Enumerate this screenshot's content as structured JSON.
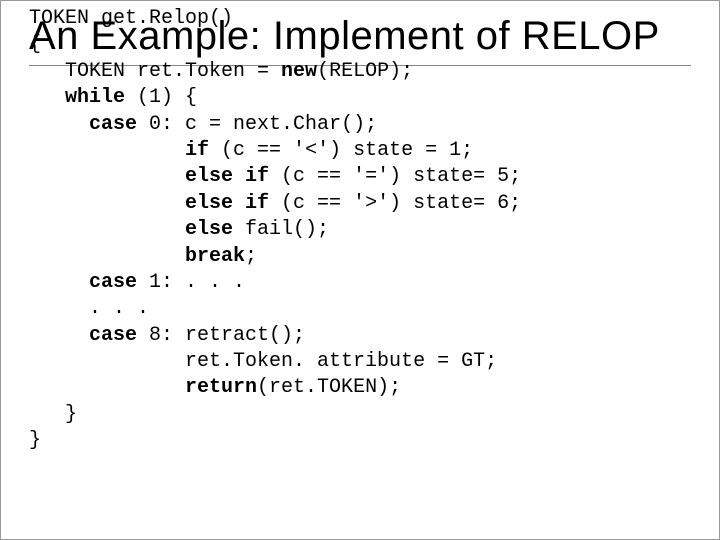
{
  "title": "An Example: Implement of RELOP",
  "code": {
    "l01a": "TOKEN get.Relop()",
    "l02a": "{",
    "l03a": "   TOKEN ret.Token = ",
    "l03b": "new",
    "l03c": "(RELOP);",
    "l04a": "   ",
    "l04b": "while",
    "l04c": " (1) {",
    "l05a": "     ",
    "l05b": "case",
    "l05c": " 0: c = next.Char();",
    "l06a": "             ",
    "l06b": "if",
    "l06c": " (c == '<') state = 1;",
    "l07a": "             ",
    "l07b": "else if",
    "l07c": " (c == '=') state= 5;",
    "l08a": "             ",
    "l08b": "else if",
    "l08c": " (c == '>') state= 6;",
    "l09a": "             ",
    "l09b": "else",
    "l09c": " fail();",
    "l10a": "             ",
    "l10b": "break",
    "l10c": ";",
    "l11a": "     ",
    "l11b": "case",
    "l11c": " 1: . . .",
    "l12a": "     . . .",
    "l13a": "     ",
    "l13b": "case",
    "l13c": " 8: retract();",
    "l14a": "             ret.Token. attribute = GT;",
    "l15a": "             ",
    "l15b": "return",
    "l15c": "(ret.TOKEN);",
    "l16a": "   }",
    "l17a": "}"
  }
}
